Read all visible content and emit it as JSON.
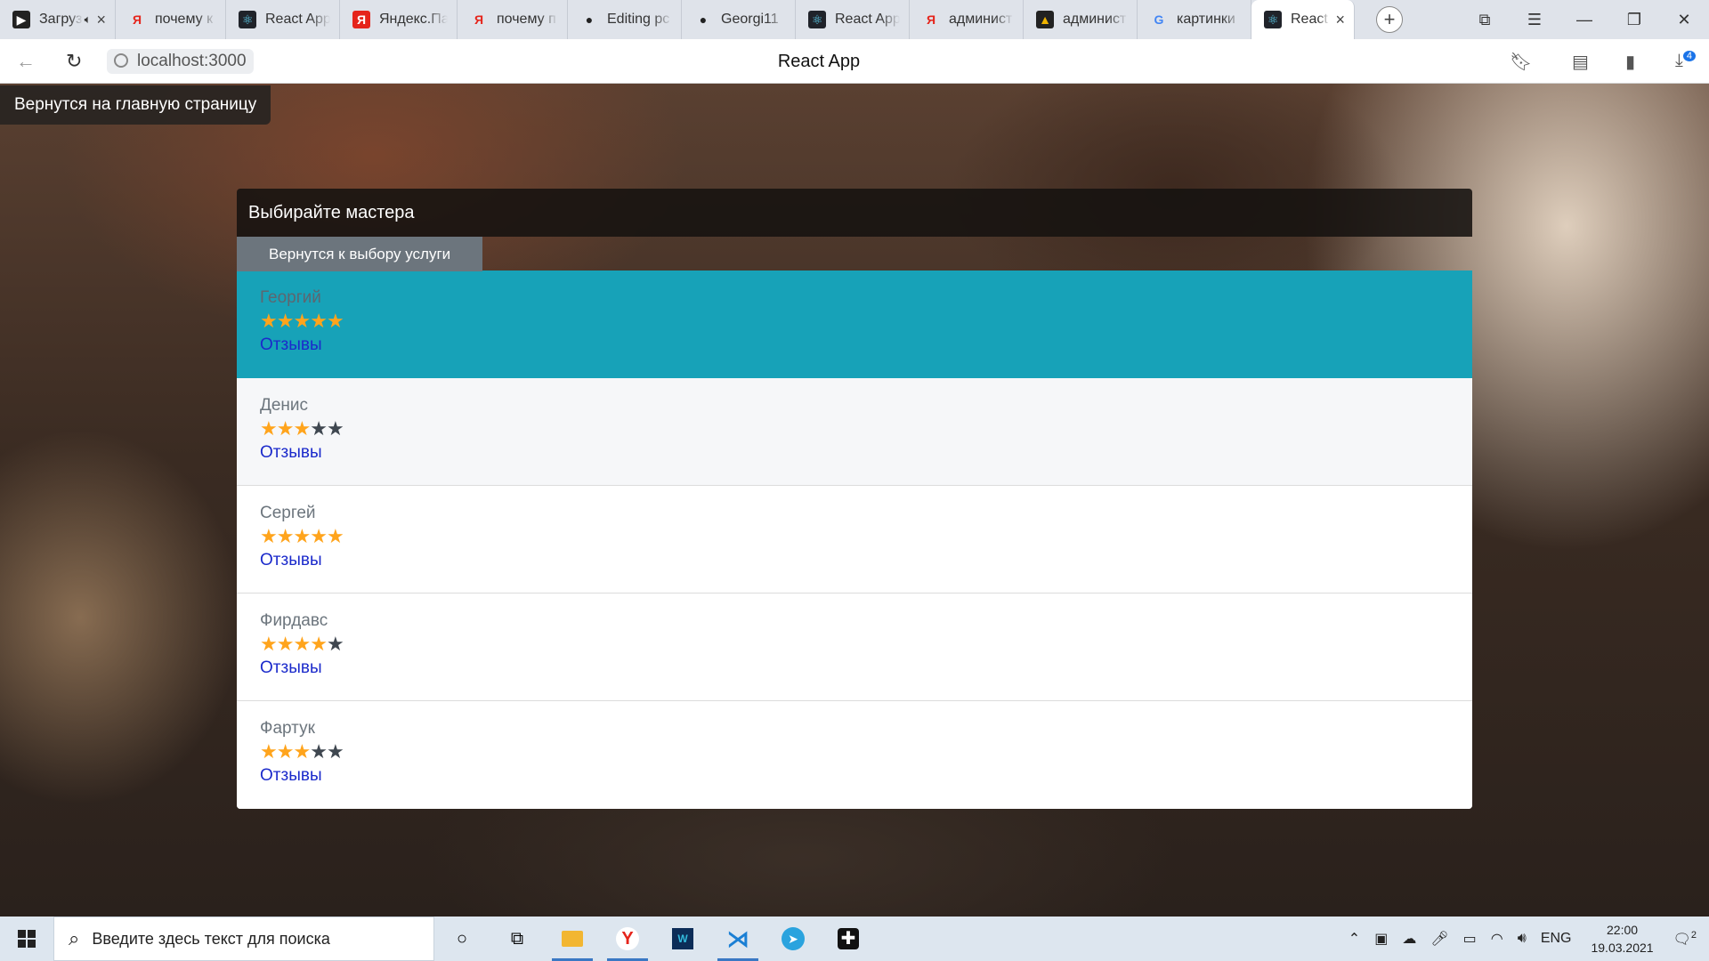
{
  "browser": {
    "tabs": [
      {
        "title": "Загрузка",
        "favicon": "youtube-icon",
        "audio": true
      },
      {
        "title": "почему к",
        "favicon": "yandex-icon"
      },
      {
        "title": "React App",
        "favicon": "react-icon"
      },
      {
        "title": "Яндекс.Паспорт",
        "favicon": "yandex-passport-icon"
      },
      {
        "title": "почему п",
        "favicon": "yandex-icon"
      },
      {
        "title": "Editing pc",
        "favicon": "github-icon"
      },
      {
        "title": "Georgi11",
        "favicon": "github-icon"
      },
      {
        "title": "React App",
        "favicon": "react-icon"
      },
      {
        "title": "админист",
        "favicon": "yandex-icon"
      },
      {
        "title": "админист",
        "favicon": "image-icon"
      },
      {
        "title": "картинки",
        "favicon": "google-icon"
      },
      {
        "title": "React App",
        "favicon": "react-icon",
        "active": true
      }
    ],
    "url": "localhost:3000",
    "page_title": "React App",
    "downloads_badge": "4"
  },
  "page": {
    "back_home_label": "Вернутся на главную страницу",
    "card_title": "Выбирайте мастера",
    "back_service_label": "Вернутся к выбору услуги",
    "reviews_label": "Отзывы",
    "masters": [
      {
        "name": "Георгий",
        "rating": 5,
        "active": true
      },
      {
        "name": "Денис",
        "rating": 3,
        "active": false
      },
      {
        "name": "Сергей",
        "rating": 5,
        "active": false
      },
      {
        "name": "Фирдавс",
        "rating": 4,
        "active": false
      },
      {
        "name": "Фартук",
        "rating": 3,
        "active": false
      }
    ],
    "max_rating": 5
  },
  "taskbar": {
    "search_placeholder": "Введите здесь текст для поиска",
    "language": "ENG",
    "time": "22:00",
    "date": "19.03.2021",
    "notification_count": "2"
  },
  "colors": {
    "active_item": "#17a2b8",
    "star_filled": "#ffa41c",
    "star_empty": "#3f4750",
    "reviews_link": "#1b2acb",
    "secondary_button": "#6c757d"
  }
}
